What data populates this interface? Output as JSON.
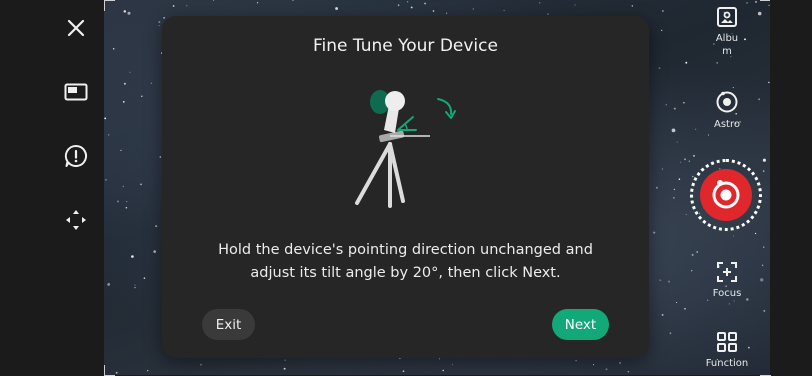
{
  "dialog": {
    "title": "Fine Tune Your Device",
    "message_line1": "Hold the device's pointing direction unchanged and",
    "message_line2": "adjust its tilt angle by 20°, then click Next.",
    "exit_label": "Exit",
    "next_label": "Next"
  },
  "left_toolbar": [
    {
      "icon": "close-icon"
    },
    {
      "icon": "picture-in-picture-icon"
    },
    {
      "icon": "alert-icon"
    },
    {
      "icon": "move-arrows-icon"
    }
  ],
  "right_toolbar": {
    "album_label": "Album",
    "astro_label": "Astro",
    "focus_label": "Focus",
    "function_label": "Function"
  },
  "colors": {
    "accent_green": "#12a877",
    "shutter_red": "#e0282c",
    "dialog_bg": "#262627"
  }
}
